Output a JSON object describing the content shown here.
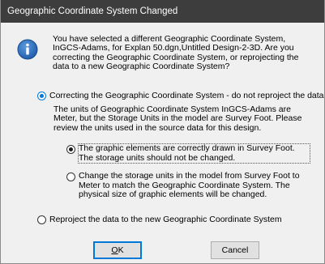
{
  "dialog": {
    "title": "Geographic Coordinate System Changed"
  },
  "icon": {
    "name": "info-icon",
    "glyph": "i",
    "color": "#1e5aa8"
  },
  "intro": {
    "text": "You have selected a different Geographic Coordinate System, InGCS-Adams, for Explan 50.dgn,Untitled Design-2-3D. Are you correcting the Geographic Coordinate System, or reprojecting the data to a new Geographic Coordinate System?"
  },
  "options": {
    "correct": {
      "label": "Correcting the Geographic Coordinate System - do not reproject the data",
      "checked": true
    },
    "note": "The units of Geographic Coordinate System InGCS-Adams are Meter, but the Storage Units in the model are Survey Foot. Please review the units used in the source data for this design.",
    "suboptions": [
      {
        "label": "The graphic elements are correctly drawn in Survey Foot. The storage units should not be changed.",
        "checked": true
      },
      {
        "label": "Change the storage units in the model from Survey Foot to Meter to match the Geographic Coordinate System. The physical size of graphic elements will be changed.",
        "checked": false
      }
    ],
    "reproject": {
      "label": "Reproject the data to the new Geographic Coordinate System",
      "checked": false
    }
  },
  "buttons": {
    "ok_mnemonic": "O",
    "ok_rest": "K",
    "cancel": "Cancel"
  },
  "colors": {
    "titlebar": "#3d3d3d",
    "dialog_bg": "#f0f0f0",
    "accent": "#0078d7"
  }
}
